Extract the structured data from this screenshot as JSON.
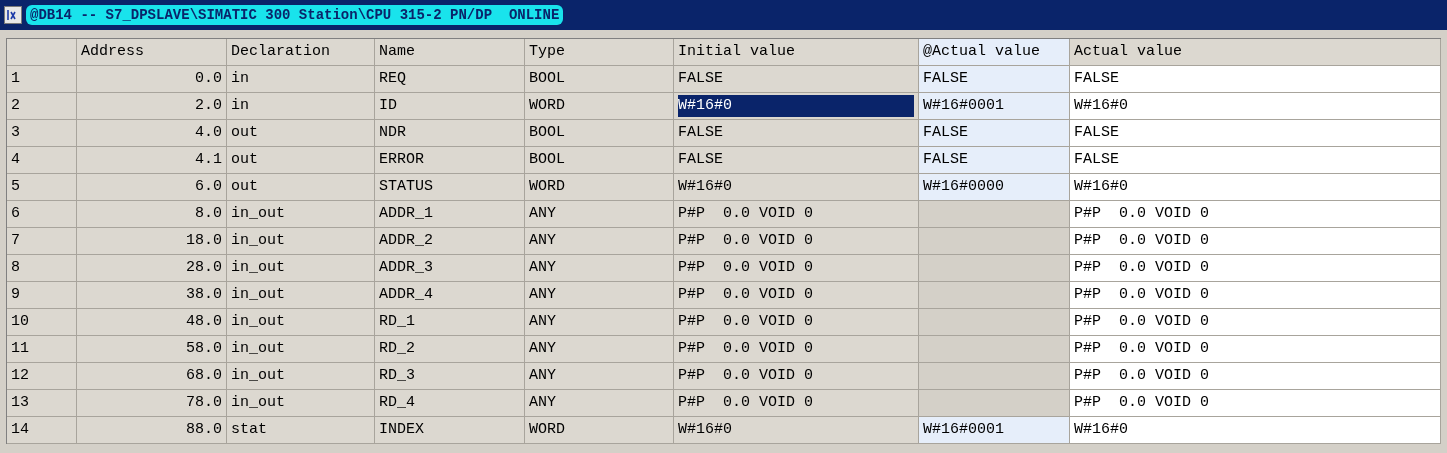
{
  "window": {
    "title": "@DB14 -- S7_DPSLAVE\\SIMATIC 300 Station\\CPU 315-2 PN/DP  ONLINE"
  },
  "table": {
    "columns": [
      "Address",
      "Declaration",
      "Name",
      "Type",
      "Initial value",
      "@Actual value",
      "Actual value"
    ],
    "rows": [
      {
        "number": "1",
        "address": "0.0",
        "declaration": "in",
        "name": "REQ",
        "type": "BOOL",
        "initial_value": "FALSE",
        "online_actual_value": "FALSE",
        "actual_value": "FALSE",
        "selected": false
      },
      {
        "number": "2",
        "address": "2.0",
        "declaration": "in",
        "name": "ID",
        "type": "WORD",
        "initial_value": "W#16#0",
        "online_actual_value": "W#16#0001",
        "actual_value": "W#16#0",
        "selected": true
      },
      {
        "number": "3",
        "address": "4.0",
        "declaration": "out",
        "name": "NDR",
        "type": "BOOL",
        "initial_value": "FALSE",
        "online_actual_value": "FALSE",
        "actual_value": "FALSE",
        "selected": false
      },
      {
        "number": "4",
        "address": "4.1",
        "declaration": "out",
        "name": "ERROR",
        "type": "BOOL",
        "initial_value": "FALSE",
        "online_actual_value": "FALSE",
        "actual_value": "FALSE",
        "selected": false
      },
      {
        "number": "5",
        "address": "6.0",
        "declaration": "out",
        "name": "STATUS",
        "type": "WORD",
        "initial_value": "W#16#0",
        "online_actual_value": "W#16#0000",
        "actual_value": "W#16#0",
        "selected": false
      },
      {
        "number": "6",
        "address": "8.0",
        "declaration": "in_out",
        "name": "ADDR_1",
        "type": "ANY",
        "initial_value": "P#P  0.0 VOID 0",
        "actual_value": "P#P  0.0 VOID 0",
        "selected": false
      },
      {
        "number": "7",
        "address": "18.0",
        "declaration": "in_out",
        "name": "ADDR_2",
        "type": "ANY",
        "initial_value": "P#P  0.0 VOID 0",
        "actual_value": "P#P  0.0 VOID 0",
        "selected": false
      },
      {
        "number": "8",
        "address": "28.0",
        "declaration": "in_out",
        "name": "ADDR_3",
        "type": "ANY",
        "initial_value": "P#P  0.0 VOID 0",
        "actual_value": "P#P  0.0 VOID 0",
        "selected": false
      },
      {
        "number": "9",
        "address": "38.0",
        "declaration": "in_out",
        "name": "ADDR_4",
        "type": "ANY",
        "initial_value": "P#P  0.0 VOID 0",
        "actual_value": "P#P  0.0 VOID 0",
        "selected": false
      },
      {
        "number": "10",
        "address": "48.0",
        "declaration": "in_out",
        "name": "RD_1",
        "type": "ANY",
        "initial_value": "P#P  0.0 VOID 0",
        "actual_value": "P#P  0.0 VOID 0",
        "selected": false
      },
      {
        "number": "11",
        "address": "58.0",
        "declaration": "in_out",
        "name": "RD_2",
        "type": "ANY",
        "initial_value": "P#P  0.0 VOID 0",
        "actual_value": "P#P  0.0 VOID 0",
        "selected": false
      },
      {
        "number": "12",
        "address": "68.0",
        "declaration": "in_out",
        "name": "RD_3",
        "type": "ANY",
        "initial_value": "P#P  0.0 VOID 0",
        "actual_value": "P#P  0.0 VOID 0",
        "selected": false
      },
      {
        "number": "13",
        "address": "78.0",
        "declaration": "in_out",
        "name": "RD_4",
        "type": "ANY",
        "initial_value": "P#P  0.0 VOID 0",
        "actual_value": "P#P  0.0 VOID 0",
        "selected": false
      },
      {
        "number": "14",
        "address": "88.0",
        "declaration": "stat",
        "name": "INDEX",
        "type": "WORD",
        "initial_value": "W#16#0",
        "online_actual_value": "W#16#0001",
        "actual_value": "W#16#0",
        "selected": false
      }
    ]
  }
}
